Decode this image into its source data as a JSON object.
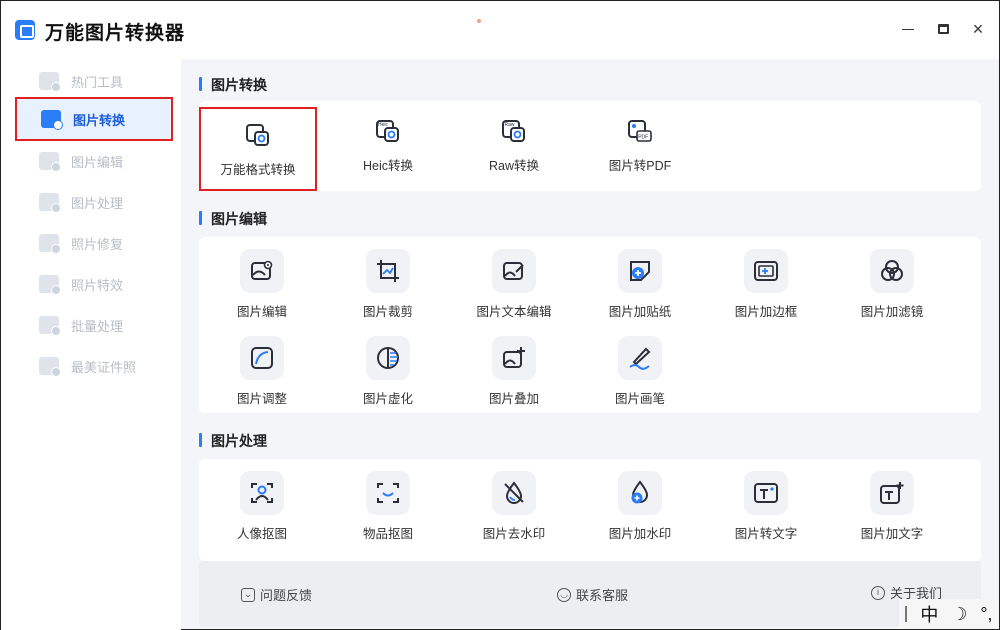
{
  "window": {
    "title": "万能图片转换器",
    "min_label": "minimize",
    "max_label": "maximize",
    "close_label": "×"
  },
  "sidebar": {
    "items": [
      {
        "label": "热门工具",
        "icon": "grid-icon",
        "active": false
      },
      {
        "label": "图片转换",
        "icon": "image-convert-icon",
        "active": true
      },
      {
        "label": "图片编辑",
        "icon": "image-edit-icon",
        "active": false
      },
      {
        "label": "图片处理",
        "icon": "image-process-icon",
        "active": false
      },
      {
        "label": "照片修复",
        "icon": "photo-repair-icon",
        "active": false
      },
      {
        "label": "照片特效",
        "icon": "photo-effect-icon",
        "active": false
      },
      {
        "label": "批量处理",
        "icon": "batch-icon",
        "active": false
      },
      {
        "label": "最美证件照",
        "icon": "id-photo-icon",
        "active": false
      }
    ]
  },
  "sections": {
    "convert": {
      "title": "图片转换",
      "tools": [
        {
          "label": "万能格式转换",
          "icon": "universal-convert-icon"
        },
        {
          "label": "Heic转换",
          "icon": "heic-convert-icon",
          "badge": "Heic"
        },
        {
          "label": "Raw转换",
          "icon": "raw-convert-icon",
          "badge": "Raw"
        },
        {
          "label": "图片转PDF",
          "icon": "image-to-pdf-icon",
          "badge": "PDF"
        }
      ]
    },
    "edit": {
      "title": "图片编辑",
      "tools": [
        {
          "label": "图片编辑",
          "icon": "image-settings-icon"
        },
        {
          "label": "图片裁剪",
          "icon": "crop-icon"
        },
        {
          "label": "图片文本编辑",
          "icon": "text-edit-icon"
        },
        {
          "label": "图片加贴纸",
          "icon": "sticker-icon"
        },
        {
          "label": "图片加边框",
          "icon": "border-icon"
        },
        {
          "label": "图片加滤镜",
          "icon": "filter-icon"
        },
        {
          "label": "图片调整",
          "icon": "adjust-icon"
        },
        {
          "label": "图片虚化",
          "icon": "blur-icon"
        },
        {
          "label": "图片叠加",
          "icon": "overlay-icon"
        },
        {
          "label": "图片画笔",
          "icon": "brush-icon"
        }
      ]
    },
    "process": {
      "title": "图片处理",
      "tools": [
        {
          "label": "人像抠图",
          "icon": "portrait-cutout-icon"
        },
        {
          "label": "物品抠图",
          "icon": "object-cutout-icon"
        },
        {
          "label": "图片去水印",
          "icon": "remove-watermark-icon"
        },
        {
          "label": "图片加水印",
          "icon": "add-watermark-icon"
        },
        {
          "label": "图片转文字",
          "icon": "image-to-text-icon"
        },
        {
          "label": "图片加文字",
          "icon": "add-text-icon"
        }
      ]
    }
  },
  "footer": {
    "feedback": "问题反馈",
    "support": "联系客服",
    "about": "关于我们"
  },
  "ime": {
    "lang": "中",
    "moon": "☽",
    "punct": "°,"
  },
  "colors": {
    "accent": "#2a7cf7",
    "highlight_border": "#e02020",
    "main_bg": "#f4f5f8"
  }
}
